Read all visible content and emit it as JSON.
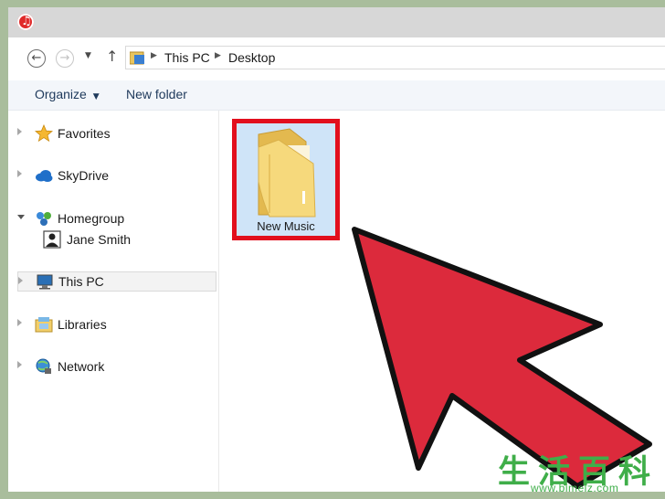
{
  "address": {
    "crumbs": [
      "This PC",
      "Desktop"
    ]
  },
  "toolbar": {
    "organize_label": "Organize",
    "new_folder_label": "New folder"
  },
  "sidebar": {
    "items": [
      {
        "label": "Favorites",
        "icon": "star-icon"
      },
      {
        "label": "SkyDrive",
        "icon": "cloud-icon"
      },
      {
        "label": "Homegroup",
        "icon": "homegroup-icon"
      },
      {
        "label": "Jane Smith",
        "icon": "user-icon"
      },
      {
        "label": "This PC",
        "icon": "computer-icon",
        "selected": true
      },
      {
        "label": "Libraries",
        "icon": "library-icon"
      },
      {
        "label": "Network",
        "icon": "network-icon"
      }
    ]
  },
  "content": {
    "folder_name": "New Music"
  },
  "colors": {
    "highlight_border": "#e20f1d",
    "arrow_fill": "#dc2a3c",
    "folder_yellow": "#f5d77a",
    "selection_blue": "#cfe4f8"
  },
  "watermark": {
    "chars": [
      "生",
      "活",
      "百",
      "科"
    ],
    "url": "www.bimeiz.com"
  }
}
